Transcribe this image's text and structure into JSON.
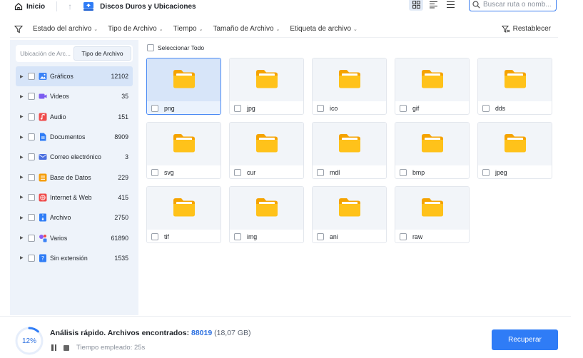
{
  "topbar": {
    "home_label": "Inicio",
    "path_title": "Discos Duros y Ubicaciones",
    "search_placeholder": "Buscar ruta o nomb..."
  },
  "filters": {
    "items": [
      "Estado del archivo",
      "Tipo de Archivo",
      "Tiempo",
      "Tamaño de Archivo",
      "Etiqueta de archivo"
    ],
    "reset_label": "Restablecer"
  },
  "sidebar": {
    "tabs": [
      "Ubicación de Arc...",
      "Tipo de Archivo"
    ],
    "active_tab": 1,
    "categories": [
      {
        "label": "Gráficos",
        "count": "12102",
        "icon": "image-icon",
        "color": "#3b82f6"
      },
      {
        "label": "Videos",
        "count": "35",
        "icon": "video-icon",
        "color": "#7c5cf0"
      },
      {
        "label": "Audio",
        "count": "151",
        "icon": "music-icon",
        "color": "#ef4b4b"
      },
      {
        "label": "Documentos",
        "count": "8909",
        "icon": "document-icon",
        "color": "#2f7cf6"
      },
      {
        "label": "Correo electrónico",
        "count": "3",
        "icon": "mail-icon",
        "color": "#4a6ee0"
      },
      {
        "label": "Base de Datos",
        "count": "229",
        "icon": "database-icon",
        "color": "#f59e0b"
      },
      {
        "label": "Internet & Web",
        "count": "415",
        "icon": "web-icon",
        "color": "#ef4b4b"
      },
      {
        "label": "Archivo",
        "count": "2750",
        "icon": "archive-icon",
        "color": "#2f7cf6"
      },
      {
        "label": "Varios",
        "count": "61890",
        "icon": "misc-icon",
        "color": "#8b5cf6"
      },
      {
        "label": "Sin extensión",
        "count": "1535",
        "icon": "unknown-file-icon",
        "color": "#2f7cf6"
      }
    ]
  },
  "main": {
    "select_all_label": "Seleccionar Todo",
    "folders": [
      "png",
      "jpg",
      "ico",
      "gif",
      "dds",
      "svg",
      "cur",
      "mdl",
      "bmp",
      "jpeg",
      "tif",
      "img",
      "ani",
      "raw"
    ],
    "selected_folder": "png"
  },
  "status": {
    "percent": "12%",
    "progress_fraction": 0.12,
    "scan_label": "Análisis rápido. Archivos encontrados:",
    "found_count": "88019",
    "found_size": "(18,07 GB)",
    "elapsed_label": "Tiempo empleado: 25s",
    "recover_label": "Recuperar"
  },
  "colors": {
    "accent": "#2f7cf6",
    "folder": "#ffc21a",
    "sidebar_bg": "#eef3fa"
  }
}
